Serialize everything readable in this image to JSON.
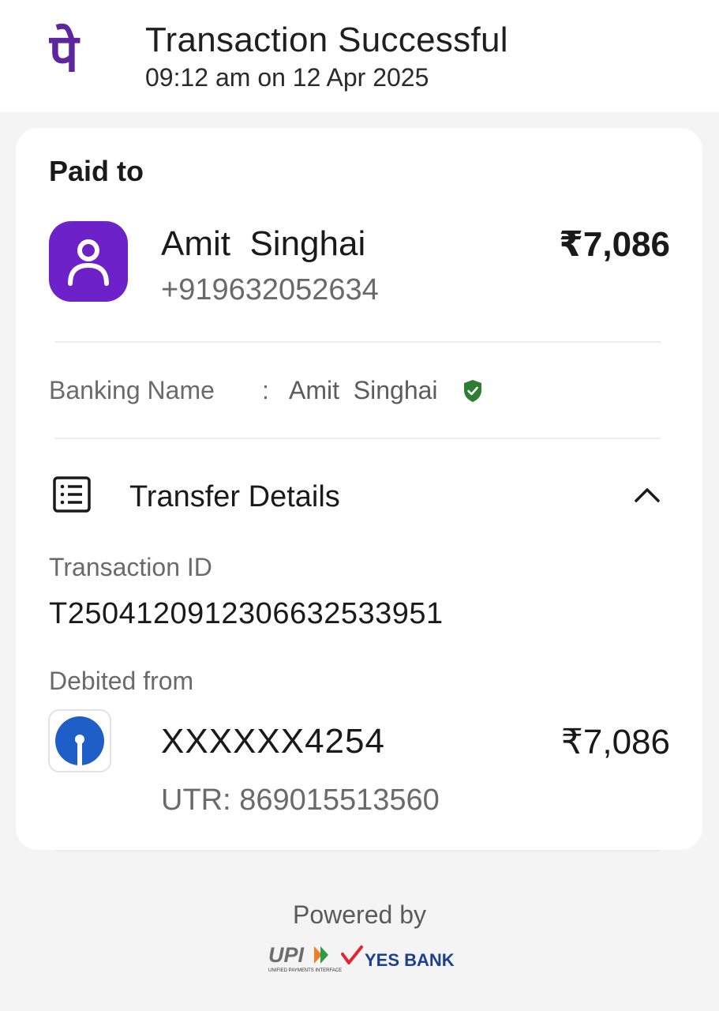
{
  "header": {
    "title": "Transaction Successful",
    "timestamp": "09:12 am on 12 Apr 2025",
    "logo_glyph": "पे",
    "brand_color": "#5f259f"
  },
  "payment": {
    "paid_to_label": "Paid to",
    "payee_name": "Amit  Singhai",
    "payee_phone": "+919632052634",
    "amount": "₹7,086",
    "avatar_icon": "user-icon",
    "avatar_color": "#6c22c8"
  },
  "banking": {
    "label": "Banking Name",
    "separator": ":",
    "value": "Amit  Singhai",
    "verified_icon": "verified-shield-icon",
    "verified_color": "#2e7d32"
  },
  "transfer_details": {
    "title": "Transfer Details",
    "icon": "receipt-list-icon",
    "toggle_icon": "chevron-up-icon",
    "transaction_id_label": "Transaction ID",
    "transaction_id": "T2504120912306632533951",
    "debited_from_label": "Debited from",
    "account": "XXXXXX4254",
    "debit_amount": "₹7,086",
    "utr": "UTR: 869015513560",
    "bank_icon": "sbi-bank-icon"
  },
  "footer": {
    "powered_by": "Powered by",
    "upi_logo": "UPI",
    "upi_tagline": "UNIFIED PAYMENTS INTERFACE",
    "bank_logo": "YES BANK"
  }
}
